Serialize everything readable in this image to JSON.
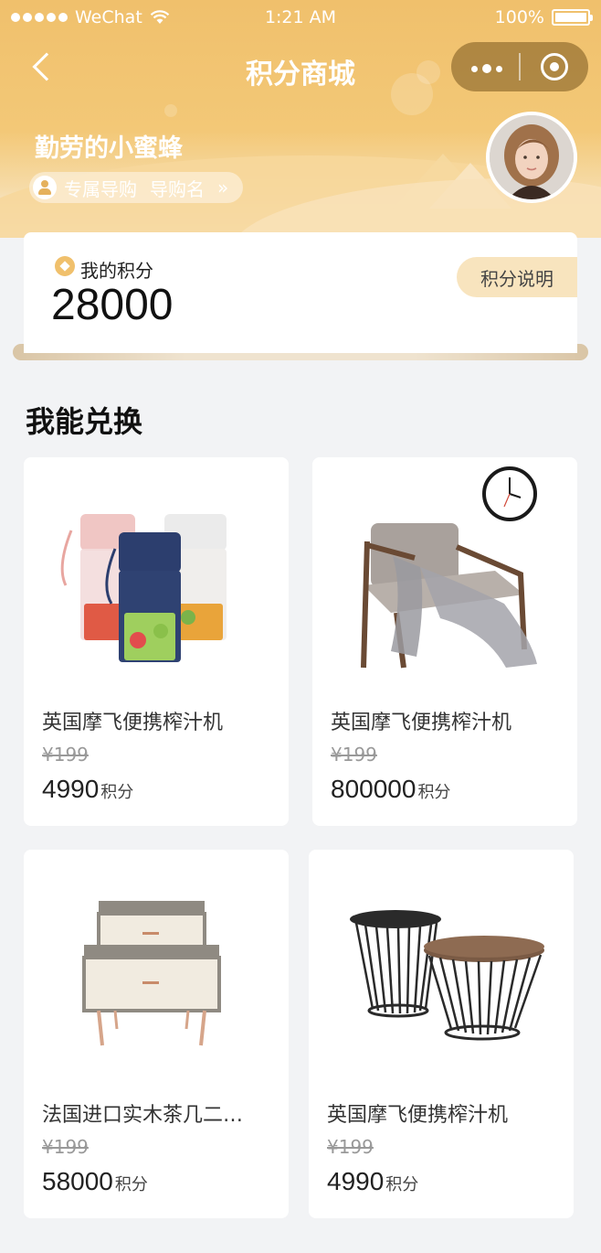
{
  "status_bar": {
    "carrier": "WeChat",
    "time": "1:21 AM",
    "battery": "100%"
  },
  "nav": {
    "title": "积分商城"
  },
  "user": {
    "name": "勤劳的小蜜蜂",
    "guide_label": "专属导购",
    "guide_name": "导购名",
    "chevron": "»"
  },
  "points": {
    "label": "我的积分",
    "value": "28000",
    "rules_button": "积分说明"
  },
  "section": {
    "title": "我能兑换"
  },
  "products": [
    {
      "name": "英国摩飞便携榨汁机",
      "old_price": "¥199",
      "points": "4990",
      "unit": "积分"
    },
    {
      "name": "英国摩飞便携榨汁机",
      "old_price": "¥199",
      "points": "800000",
      "unit": "积分"
    },
    {
      "name": "法国进口实木茶几二…",
      "old_price": "¥199",
      "points": "58000",
      "unit": "积分"
    },
    {
      "name": "英国摩飞便携榨汁机",
      "old_price": "¥199",
      "points": "4990",
      "unit": "积分"
    }
  ]
}
